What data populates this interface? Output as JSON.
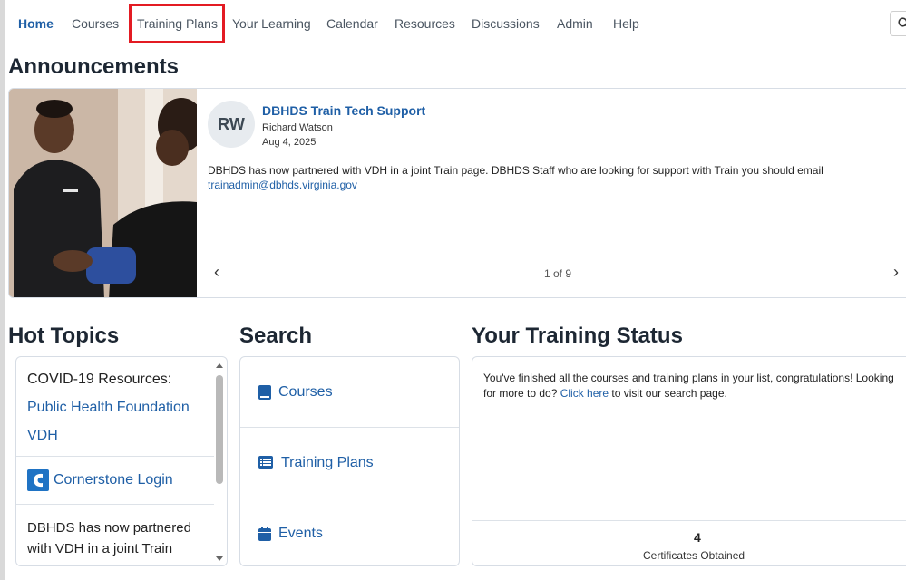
{
  "nav": {
    "items": [
      "Home",
      "Courses",
      "Training Plans",
      "Your Learning",
      "Calendar",
      "Resources",
      "Discussions",
      "Admin",
      "Help"
    ]
  },
  "announcements": {
    "heading": "Announcements",
    "avatar_initials": "RW",
    "title": "DBHDS Train Tech Support",
    "author": "Richard Watson",
    "date": "Aug 4, 2025",
    "body": "DBHDS has now partnered with VDH in a joint Train page. DBHDS Staff who are looking for support with Train you should email",
    "email": "trainadmin@dbhds.virginia.gov",
    "pager": "1 of 9",
    "prev_icon": "chevron-left-icon",
    "next_icon": "chevron-right-icon"
  },
  "hot_topics": {
    "heading": "Hot Topics",
    "resources_title": "COVID-19 Resources:",
    "links": [
      "Public Health Foundation",
      "VDH"
    ],
    "cornerstone_label": "Cornerstone Login",
    "body_text": "DBHDS has now partnered with VDH in a joint Train page. DBHDS"
  },
  "search": {
    "heading": "Search",
    "items": [
      {
        "label": "Courses",
        "icon": "book-icon"
      },
      {
        "label": "Training Plans",
        "icon": "list-icon"
      },
      {
        "label": "Events",
        "icon": "calendar-icon"
      }
    ]
  },
  "training_status": {
    "heading": "Your Training Status",
    "message_1": "You've finished all the courses and training plans in your list, congratulations! Looking for more to do?",
    "click_here": "Click here",
    "message_2": "to visit our search page.",
    "certificates_count": "4",
    "certificates_label": "Certificates Obtained"
  },
  "colors": {
    "link": "#1f5fa6",
    "highlight": "#e31b23"
  }
}
